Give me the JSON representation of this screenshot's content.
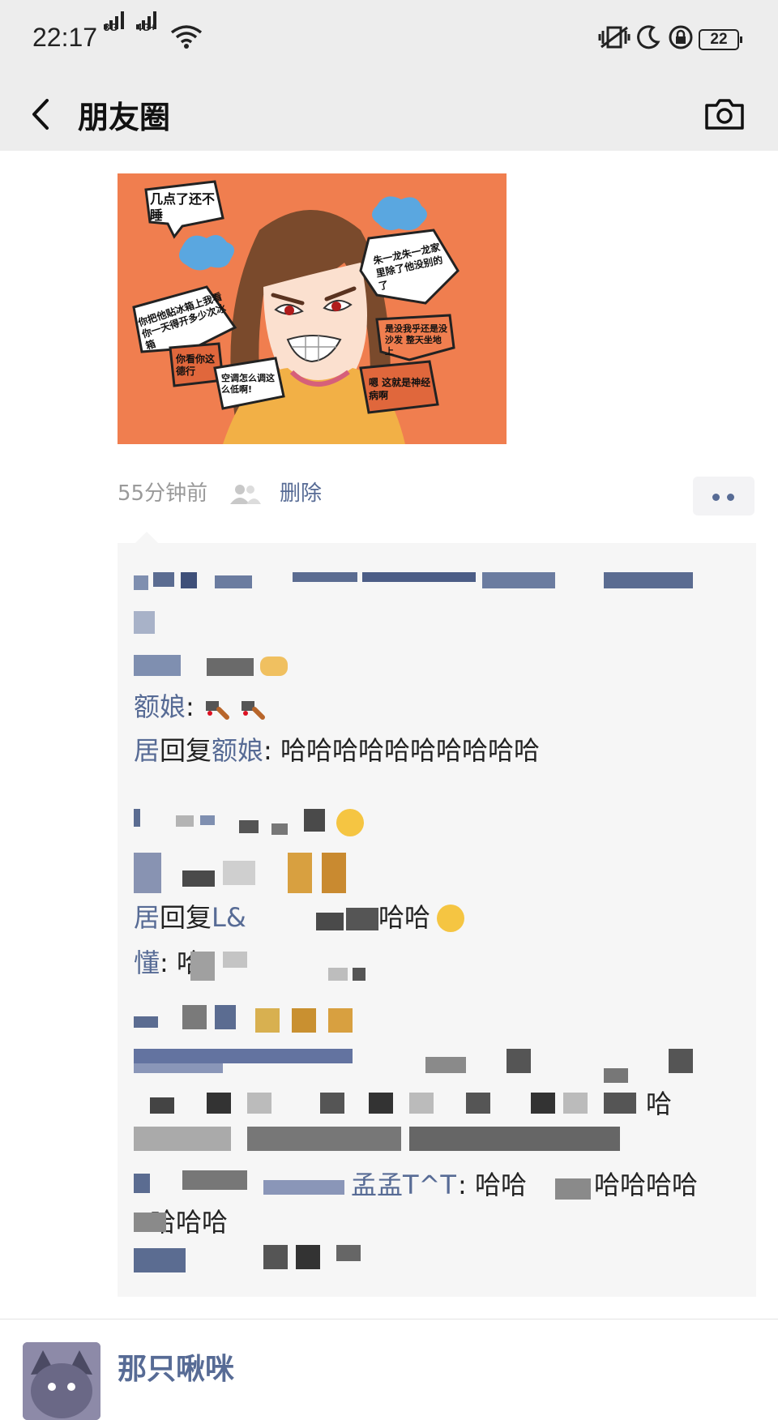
{
  "status_bar": {
    "time": "22:17",
    "net1": "3G",
    "net2": "4G+",
    "battery": "22"
  },
  "nav": {
    "title": "朋友圈"
  },
  "post": {
    "image_texts": {
      "bubble1": "几点了还不睡",
      "bubble2": "朱一龙朱一龙家里除了他没别的了",
      "bubble3": "你把他贴冰箱上我看你一天得开多少次冰箱",
      "bubble4": "是没我乎还是没沙发 整天坐地上",
      "bubble5": "你看你这德行",
      "bubble6": "空调怎么调这么低啊!",
      "bubble7": "嗯 这就是神经病啊"
    },
    "time_ago": "55分钟前",
    "delete_label": "删除"
  },
  "comments": {
    "c3_name": "额娘",
    "c3_sep": ": ",
    "c4_name1": "居",
    "c4_reply": "回复",
    "c4_name2": "额娘",
    "c4_text": ": 哈哈哈哈哈哈哈哈哈哈",
    "c7_name1": "居",
    "c7_reply": "回复",
    "c7_name2": "L&",
    "c7_text": "哈哈",
    "c8_name": "懂",
    "c8_sep": ": 哈",
    "c10_tail": "哈",
    "c11_name": "孟孟T^T",
    "c11_text": ": 哈哈",
    "c11_tail": "哈哈哈哈",
    "c12_text": "哈哈哈"
  },
  "next_post": {
    "name": "那只啾咪"
  }
}
